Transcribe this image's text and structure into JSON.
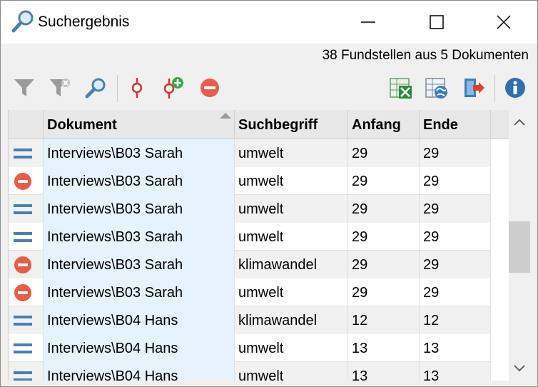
{
  "window": {
    "title": "Suchergebnis"
  },
  "summary": "38 Fundstellen aus 5 Dokumenten",
  "toolbar": {
    "icons": [
      "filter-icon",
      "filter-remove-icon",
      "search-icon",
      "code-icon",
      "code-add-icon",
      "delete-icon",
      "excel-export-icon",
      "web-export-icon",
      "export-icon",
      "info-icon"
    ]
  },
  "colors": {
    "accent_blue": "#4a7fb5",
    "delete_red": "#e85c4a",
    "code_red": "#d6322a",
    "doc_column_bg": "#e6f2fc",
    "excel_green": "#2f8a3c"
  },
  "table": {
    "columns": [
      "Dokument",
      "Suchbegriff",
      "Anfang",
      "Ende"
    ],
    "rows": [
      {
        "status": "equals-icon",
        "doc": "Interviews\\B03 Sarah",
        "term": "umwelt",
        "start": "29",
        "end": "29"
      },
      {
        "status": "delete-icon",
        "doc": "Interviews\\B03 Sarah",
        "term": "umwelt",
        "start": "29",
        "end": "29"
      },
      {
        "status": "equals-icon",
        "doc": "Interviews\\B03 Sarah",
        "term": "umwelt",
        "start": "29",
        "end": "29"
      },
      {
        "status": "equals-icon",
        "doc": "Interviews\\B03 Sarah",
        "term": "umwelt",
        "start": "29",
        "end": "29"
      },
      {
        "status": "delete-icon",
        "doc": "Interviews\\B03 Sarah",
        "term": "klimawandel",
        "start": "29",
        "end": "29"
      },
      {
        "status": "delete-icon",
        "doc": "Interviews\\B03 Sarah",
        "term": "umwelt",
        "start": "29",
        "end": "29"
      },
      {
        "status": "equals-icon",
        "doc": "Interviews\\B04 Hans",
        "term": "klimawandel",
        "start": "12",
        "end": "12"
      },
      {
        "status": "equals-icon",
        "doc": "Interviews\\B04 Hans",
        "term": "umwelt",
        "start": "13",
        "end": "13"
      },
      {
        "status": "equals-icon",
        "doc": "Interviews\\B04 Hans",
        "term": "umwelt",
        "start": "13",
        "end": "13"
      }
    ]
  }
}
